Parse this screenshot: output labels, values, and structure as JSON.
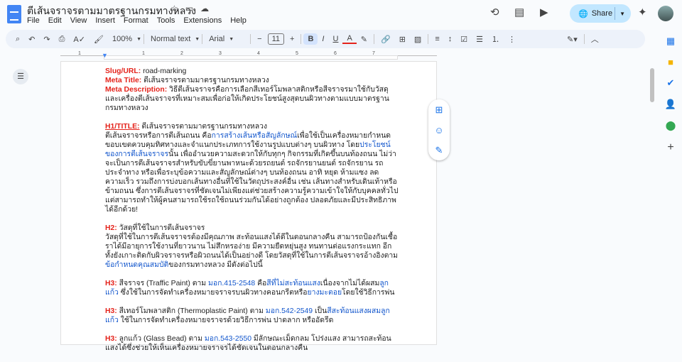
{
  "header": {
    "title": "ตีเส้นจราจรตามมาตรฐานกรมทางหลวง",
    "share_label": "Share",
    "menu": [
      "File",
      "Edit",
      "View",
      "Insert",
      "Format",
      "Tools",
      "Extensions",
      "Help"
    ]
  },
  "toolbar": {
    "zoom": "100%",
    "style": "Normal text",
    "font": "Arial",
    "font_size": "11"
  },
  "ruler": {
    "ticks": [
      "1",
      "1",
      "2",
      "3",
      "4",
      "5",
      "6",
      "7"
    ]
  },
  "document": {
    "paragraphs": [
      [
        [
          {
            "t": "Slug/URL:",
            "c": "red"
          },
          {
            "t": " road-marking",
            "c": ""
          }
        ],
        [
          {
            "t": "Meta Title:",
            "c": "red"
          },
          {
            "t": " ตีเส้นจราจรตามมาตรฐานกรมทางหลวง",
            "c": ""
          }
        ],
        [
          {
            "t": "Meta Description:",
            "c": "red"
          },
          {
            "t": " วิธีตีเส้นจราจรคือการเลือกสีเทอร์โมพลาสติกหรือสีจราจรมาใช้กับวัสดุและเครื่องตีเส้นจราจรที่เหมาะสมเพื่อก่อให้เกิดประโยชน์สูงสุดบนผิวทางตามแบบมาตรฐานกรมทางหลวง",
            "c": ""
          }
        ]
      ],
      [
        [
          {
            "t": "H1/TITLE:",
            "c": "h1"
          },
          {
            "t": " ตีเส้นจราจรตามมาตรฐานกรมทางหลวง",
            "c": ""
          }
        ],
        [
          {
            "t": "ตีเส้นจราจรหรือการตีเส้นถนน คือ",
            "c": ""
          },
          {
            "t": "การสร้างเส้นหรือสัญลักษณ์",
            "c": "blue"
          },
          {
            "t": "เพื่อใช้เป็นเครื่องหมายกำหนดขอบเขตควบคุมทิศทางและจำแนกประเภทการใช้งานรูปแบบต่างๆ บนผิวทาง โดย",
            "c": ""
          },
          {
            "t": "ประโยชน์ของการตีเส้นจราจร",
            "c": "blue"
          },
          {
            "t": "นั้น เพื่ออำนวยความสะดวกให้กับทุกๆ กิจกรรมที่เกิดขึ้นบนท้องถนน ไม่ว่าจะเป็นการตีเส้นจราจรสำหรับขับขี่ยานพาหนะด้วยรถยนต์ รถจักรยานยนต์ รถจักรยาน รถประจำทาง หรือเพื่อระบุข้อความและสัญลักษณ์ต่างๆ บนท้องถนน อาทิ หยุด ห้ามแซง ลดความเร็ว รวมถึงการบ่งบอกเส้นทางอื่นที่ใช้ในวัตถุประสงค์อื่น เช่น เส้นทางสำหรับเดินเท้าหรือข้ามถนน ซึ่งการตีเส้นจราจรที่ชัดเจนไม่เพียงแต่ช่วยสร้างความรู้ความเข้าใจให้กับบุคคลทั่วไป แต่สามารถทำให้ผู้คนสามารถใช้รถใช้ถนนร่วมกันได้อย่างถูกต้อง ปลอดภัยและมีประสิทธิภาพได้อีกด้วย!",
            "c": ""
          }
        ]
      ],
      [
        [
          {
            "t": "H2:",
            "c": "red"
          },
          {
            "t": " วัสดุที่ใช้ในการตีเส้นจราจร",
            "c": ""
          }
        ],
        [
          {
            "t": "วัสดุที่ใช้ในการตีเส้นจราจรต้องมีคุณภาพ สะท้อนแสงได้ดีในตอนกลางคืน สามารถป้องกันเชื้อราได้มีอายุการใช้งานที่ยาวนาน ไม่สึกหรอง่าย มีความยืดหยุ่นสูง ทนทานต่อแรงกระแทก อีกทั้งยังเกาะติดกับผิวจราจรหรือผิวถนนได้เป็นอย่างดี โดยวัสดุที่ใช้ในการตีเส้นจราจรอ้างอิงตาม",
            "c": ""
          },
          {
            "t": "ข้อกำหนดคุณสมบัติ",
            "c": "blue"
          },
          {
            "t": "ของกรมทางหลวง มีดังต่อไปนี้",
            "c": ""
          }
        ]
      ],
      [
        [
          {
            "t": "H3:",
            "c": "red"
          },
          {
            "t": " สีจราจร (Traffic Paint) ตาม ",
            "c": ""
          },
          {
            "t": "มอก.415-2548",
            "c": "blue"
          },
          {
            "t": " คือ",
            "c": ""
          },
          {
            "t": "สีที่ไม่สะท้อนแสง",
            "c": "blue"
          },
          {
            "t": "เนื่องจากไม่ได้ผสม",
            "c": ""
          },
          {
            "t": "ลูกแก้ว",
            "c": "blue"
          },
          {
            "t": " ซึ่งใช้ในการจัดทำเครื่องหมายจราจรบนผิวทางคอนกรีตหรือ",
            "c": ""
          },
          {
            "t": "ยางมะตอย",
            "c": "blue"
          },
          {
            "t": "โดยใช้วิธีการพ่น",
            "c": ""
          }
        ]
      ],
      [
        [
          {
            "t": "H3:",
            "c": "red"
          },
          {
            "t": " สีเทอร์โมพลาสติก (Thermoplastic Paint) ตาม ",
            "c": ""
          },
          {
            "t": "มอก.542-2549",
            "c": "blue"
          },
          {
            "t": " เป็น",
            "c": ""
          },
          {
            "t": "สีสะท้อนแสงผสมลูกแก้ว",
            "c": "blue"
          },
          {
            "t": " ใช้ในการจัดทำเครื่องหมายจราจรด้วยวิธีการพ่น ปาดลาก หรืออัดรีด",
            "c": ""
          }
        ]
      ],
      [
        [
          {
            "t": "H3:",
            "c": "red"
          },
          {
            "t": " ลูกแก้ว (Glass Bead) ตาม ",
            "c": ""
          },
          {
            "t": "มอก.543-2550",
            "c": "blue"
          },
          {
            "t": " มีลักษณะเม็ดกลม โปร่งแสง สามารถสะท้อนแสงได้ซึ่งช่วยให้เห็นเครื่องหมายจราจรได้ชัดเจนในตอนกลางคืน",
            "c": ""
          }
        ]
      ]
    ]
  }
}
